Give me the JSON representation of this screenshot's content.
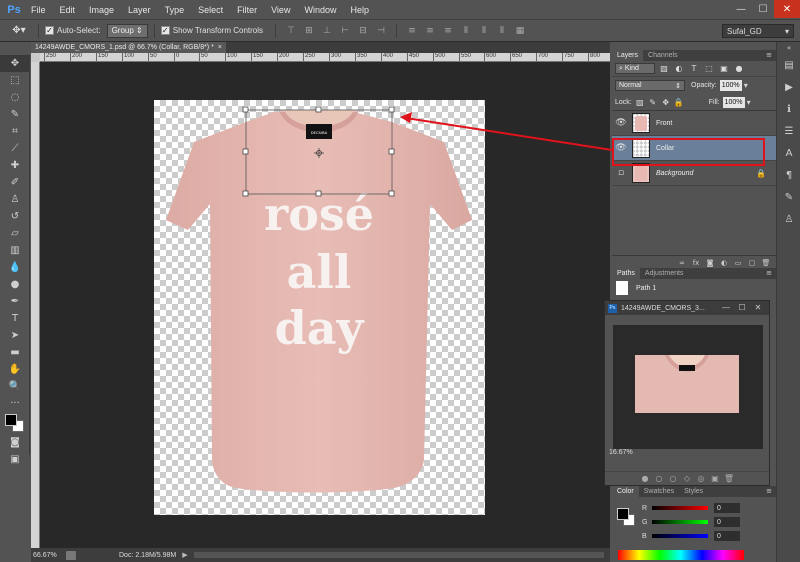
{
  "app": {
    "logo": "Ps"
  },
  "menu": [
    "File",
    "Edit",
    "Image",
    "Layer",
    "Type",
    "Select",
    "Filter",
    "View",
    "Window",
    "Help"
  ],
  "options": {
    "auto_select_label": "Auto-Select:",
    "auto_select_value": "Group",
    "transform_label": "Show Transform Controls",
    "workspace": "Sufal_GD"
  },
  "document": {
    "tab_title": "14249AWDE_CMORS_1.psd @ 66.7% (Collar, RGB/8*) *",
    "tab_close": "×",
    "zoom": "66.67%",
    "doc_info": "Doc: 2.18M/5.98M",
    "ruler_ticks": [
      "250",
      "200",
      "150",
      "100",
      "50",
      "0",
      "50",
      "100",
      "150",
      "200",
      "250",
      "300",
      "350",
      "400",
      "450",
      "500",
      "550",
      "600",
      "650",
      "700",
      "750",
      "800"
    ],
    "tshirt_text": [
      "rosé",
      "all",
      "day"
    ],
    "label_text": "DECIUBA"
  },
  "layers_panel": {
    "tabs": [
      "Layers",
      "Channels"
    ],
    "filter": "Kind",
    "blend_mode": "Normal",
    "opacity_label": "Opacity:",
    "opacity": "100%",
    "lock_label": "Lock:",
    "fill_label": "Fill:",
    "fill": "100%",
    "layers": [
      {
        "name": "Front",
        "selected": false
      },
      {
        "name": "Collar",
        "selected": true
      },
      {
        "name": "Background",
        "selected": false
      }
    ]
  },
  "paths_panel": {
    "tabs": [
      "Paths",
      "Adjustments"
    ],
    "paths": [
      "Path 1"
    ]
  },
  "navigator": {
    "title": "14249AWDE_CMORS_3...",
    "zoom": "16.67%"
  },
  "color_panel": {
    "tabs": [
      "Color",
      "Swatches",
      "Styles"
    ],
    "channels": [
      {
        "label": "R",
        "value": "0"
      },
      {
        "label": "G",
        "value": "0"
      },
      {
        "label": "B",
        "value": "0"
      }
    ]
  },
  "colors": {
    "accent_selection": "#6a7f99",
    "annotation_red": "#e0121b",
    "tshirt": "#e6bab3"
  }
}
